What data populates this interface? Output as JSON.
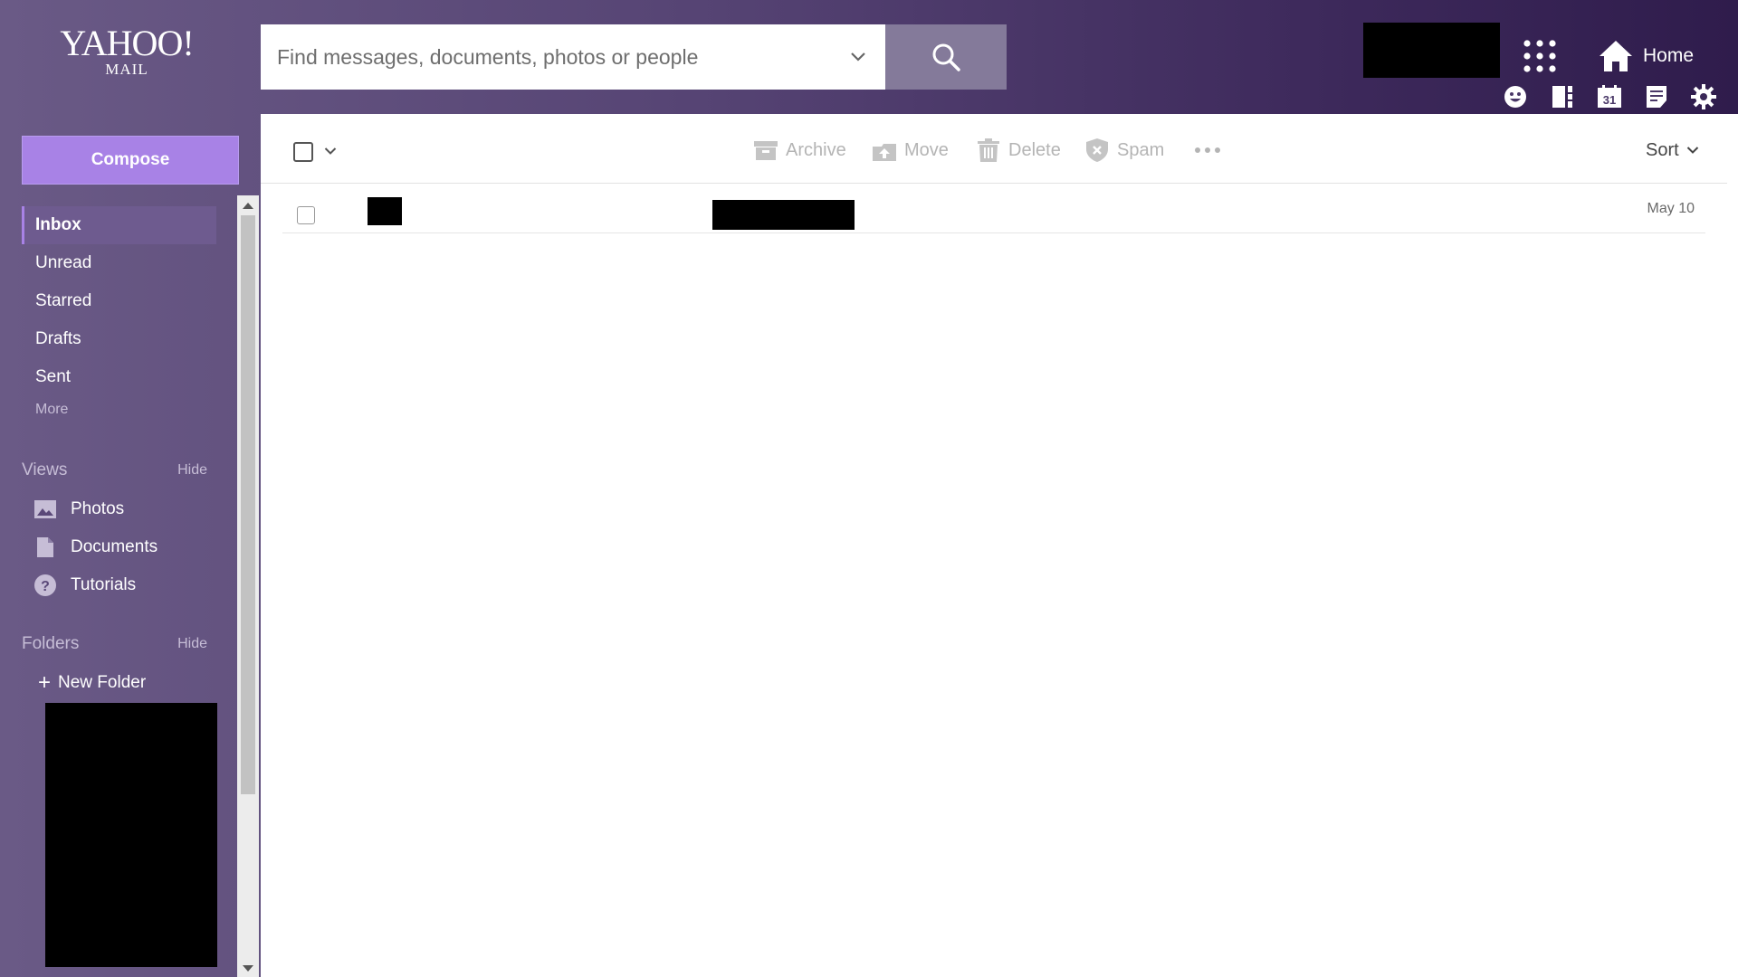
{
  "logo": {
    "line1": "YAHOO!",
    "line2": "MAIL"
  },
  "search": {
    "placeholder": "Find messages, documents, photos or people"
  },
  "header": {
    "home_label": "Home"
  },
  "sidebar": {
    "compose_label": "Compose",
    "folders": [
      {
        "label": "Inbox",
        "active": true
      },
      {
        "label": "Unread"
      },
      {
        "label": "Starred"
      },
      {
        "label": "Drafts"
      },
      {
        "label": "Sent"
      }
    ],
    "more_label": "More",
    "views": {
      "title": "Views",
      "hide_label": "Hide",
      "items": [
        {
          "label": "Photos",
          "icon": "photo-icon"
        },
        {
          "label": "Documents",
          "icon": "document-icon"
        },
        {
          "label": "Tutorials",
          "icon": "help-icon"
        }
      ]
    },
    "user_folders": {
      "title": "Folders",
      "hide_label": "Hide",
      "new_folder_label": "New Folder"
    }
  },
  "toolbar": {
    "archive_label": "Archive",
    "move_label": "Move",
    "delete_label": "Delete",
    "spam_label": "Spam",
    "sort_label": "Sort"
  },
  "messages": [
    {
      "date": "May 10"
    }
  ],
  "colors": {
    "accent": "#a882e6",
    "header_bg_start": "#6a5a86",
    "header_bg_end": "#2f1c4c"
  }
}
